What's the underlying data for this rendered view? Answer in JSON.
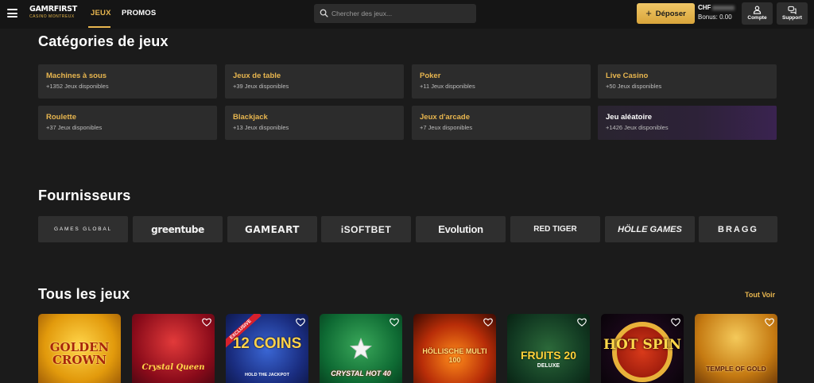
{
  "header": {
    "logo_text": "GAMRFIRST",
    "logo_sub": "CASINO MONTREUX",
    "nav": [
      "JEUX",
      "PROMOS"
    ],
    "search_placeholder": "Chercher des jeux...",
    "deposit_label": "Déposer",
    "balance_currency": "CHF",
    "bonus": "Bonus: 0.00",
    "account_label": "Compte",
    "support_label": "Support"
  },
  "categories_title": "Catégories de jeux",
  "categories": [
    {
      "name": "Machines à sous",
      "count": "+1352 Jeux disponibles"
    },
    {
      "name": "Jeux de table",
      "count": "+39 Jeux disponibles"
    },
    {
      "name": "Poker",
      "count": "+11 Jeux disponibles"
    },
    {
      "name": "Live Casino",
      "count": "+50 Jeux disponibles"
    },
    {
      "name": "Roulette",
      "count": "+37 Jeux disponibles"
    },
    {
      "name": "Blackjack",
      "count": "+13 Jeux disponibles"
    },
    {
      "name": "Jeux d'arcade",
      "count": "+7 Jeux disponibles"
    },
    {
      "name": "Jeu aléatoire",
      "count": "+1426 Jeux disponibles"
    }
  ],
  "providers_title": "Fournisseurs",
  "providers": [
    "GAMES GLOBAL",
    "greentube",
    "GAMEART",
    "iSOFTBET",
    "Evolution",
    "RED TIGER",
    "HÖLLE GAMES",
    "BRAGG"
  ],
  "games_title": "Tous les jeux",
  "see_all": "Tout Voir",
  "games": [
    {
      "title": "GOLDEN CROWN",
      "badge": ""
    },
    {
      "title": "Crystal Queen",
      "badge": ""
    },
    {
      "title": "12 COINS",
      "sub": "HOLD THE JACKPOT",
      "badge": "EXCLUSIVE"
    },
    {
      "title": "CRYSTAL HOT 40",
      "badge": ""
    },
    {
      "title": "HÖLLISCHE MULTI 100",
      "badge": ""
    },
    {
      "title": "FRUITS 20",
      "sub": "DELUXE",
      "badge": ""
    },
    {
      "title": "HOT SPIN",
      "badge": ""
    },
    {
      "title": "TEMPLE OF GOLD",
      "badge": ""
    }
  ],
  "colors": {
    "accent": "#e8b64f",
    "background": "#1b1b1b",
    "card": "#2c2c2c",
    "header": "#151515"
  }
}
